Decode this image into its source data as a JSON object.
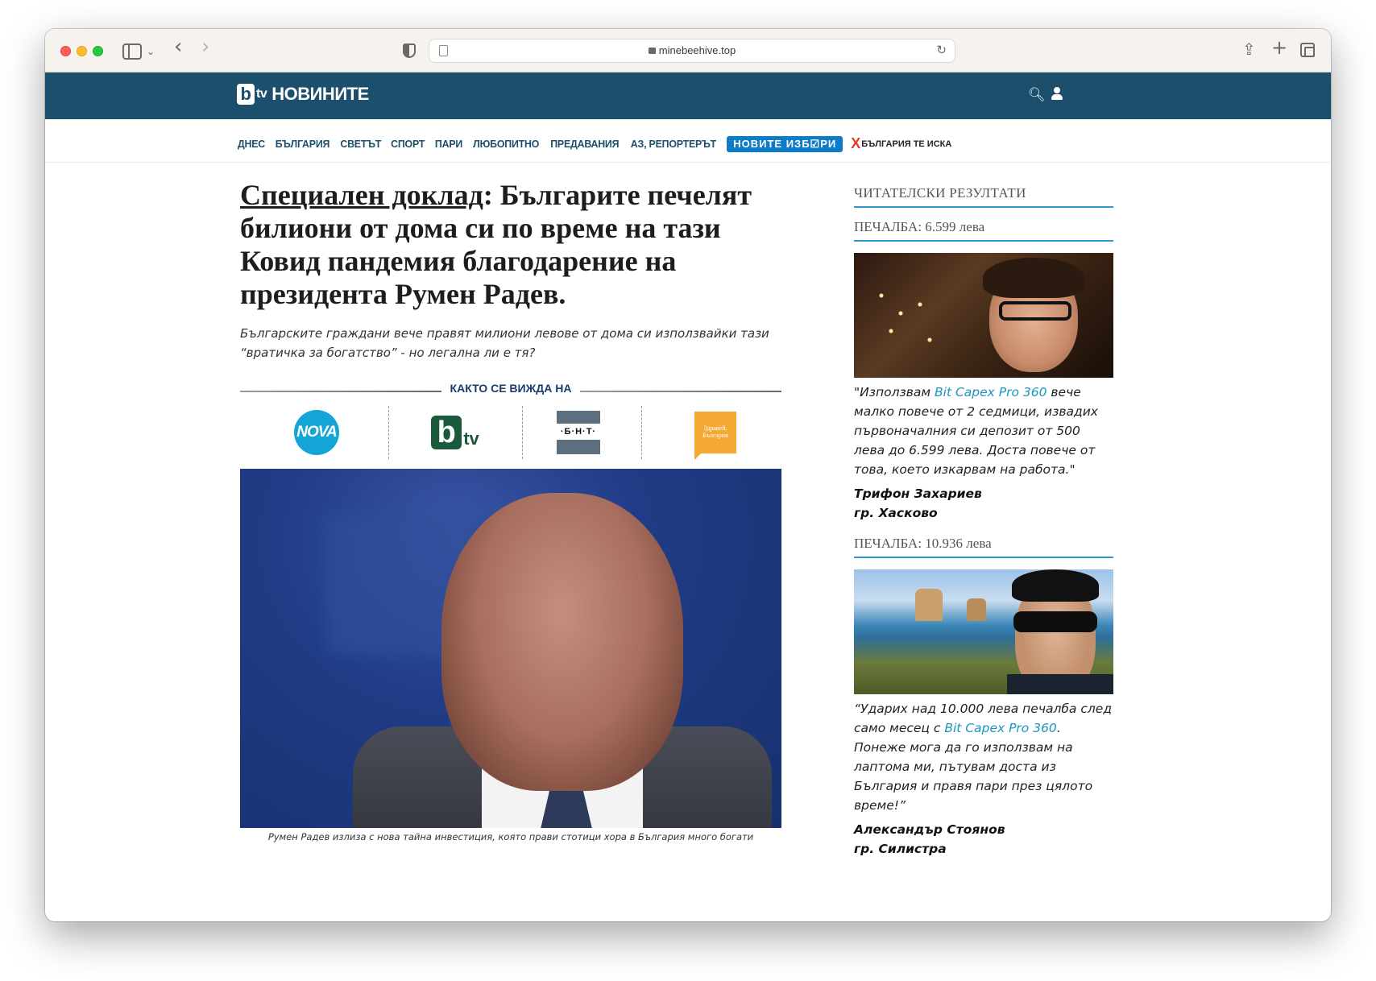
{
  "browser": {
    "url": "minebeehive.top"
  },
  "site": {
    "logo_text": "НОВИНИТЕ",
    "logo_b": "b",
    "logo_tv": "tv"
  },
  "nav": {
    "items": [
      "ДНЕС",
      "БЪЛГАРИЯ",
      "СВЕТЪТ",
      "СПОРТ",
      "ПАРИ",
      "ЛЮБОПИТНО",
      "ПРЕДАВАНИЯ",
      "АЗ, РЕПОРТЕРЪТ"
    ],
    "badge": "НОВИТЕ ИЗБ☑РИ",
    "bgk": "БЪЛГАРИЯ ТЕ ИСКА",
    "bgk_mark": "X"
  },
  "article": {
    "headline_underlined": "Специален доклад",
    "headline_rest": ": Българите печелят билиони от дома си по време на тази Ковид пандемия благодарение на президента Румен Радев.",
    "subhead": "Българските граждани вече правят милиони левове от дома си използвайки тази “вратичка за богатство” - но легална ли е тя?",
    "seen_on": "КАКТО СЕ ВИЖДА НА",
    "logos": {
      "nova": "NOVA",
      "btv_b": "b",
      "btv_tv": "tv",
      "bnt": "·Б·Н·Т·",
      "zdravei": "Здравей, България"
    },
    "caption": "Румен Радев излиза с нова тайна инвестиция, която прави стотици хора в България много богати"
  },
  "sidebar": {
    "title": "ЧИТАТЕЛСКИ РЕЗУЛТАТИ",
    "testimonials": [
      {
        "earning": "ПЕЧАЛБА: 6.599 лева",
        "quote_before": "\"Използвам ",
        "link": "Bit Capex Pro 360",
        "quote_after": " вече малко повече от 2 седмици, извадих първоначалния си депозит от 500 лева до 6.599 лева. Доста повече от това, което изкарвам на работа.\"",
        "name": "Трифон Захариев",
        "city": "гр. Хасково"
      },
      {
        "earning": "ПЕЧАЛБА: 10.936 лева",
        "quote_before": "“Ударих над 10.000 лева печалба след само месец с ",
        "link": "Bit Capex Pro 360",
        "quote_after": ". Понеже мога да го използвам на лаптома ми, пътувам доста из България и правя пари през цялото време!”",
        "name": "Александър Стоянов",
        "city": "гр. Силистра"
      }
    ]
  },
  "colors": {
    "header_bg": "#1b4f6b",
    "accent_link": "#1b95c2",
    "underline_blue": "#2e9ad0"
  }
}
